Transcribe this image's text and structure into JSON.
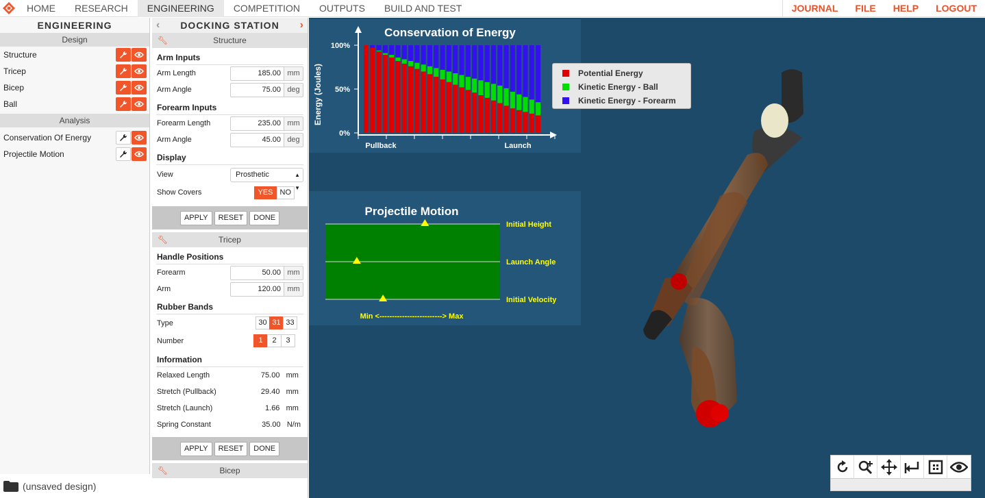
{
  "nav": {
    "items": [
      "HOME",
      "RESEARCH",
      "ENGINEERING",
      "COMPETITION",
      "OUTPUTS",
      "BUILD AND TEST"
    ],
    "active": "ENGINEERING",
    "right_items": [
      "JOURNAL",
      "FILE",
      "HELP",
      "LOGOUT"
    ],
    "accent_color": "#e8532a"
  },
  "left": {
    "title": "ENGINEERING",
    "design_label": "Design",
    "design_items": [
      "Structure",
      "Tricep",
      "Bicep",
      "Ball"
    ],
    "analysis_label": "Analysis",
    "analysis_items": [
      "Conservation Of Energy",
      "Projectile Motion"
    ],
    "footer": "(unsaved design)"
  },
  "mid": {
    "title": "DOCKING STATION",
    "structure": {
      "header": "Structure",
      "arm_inputs": "Arm Inputs",
      "arm_length_label": "Arm Length",
      "arm_length": "185.00",
      "arm_length_unit": "mm",
      "arm_angle_label": "Arm Angle",
      "arm_angle": "75.00",
      "arm_angle_unit": "deg",
      "forearm_inputs": "Forearm Inputs",
      "forearm_length_label": "Forearm Length",
      "forearm_length": "235.00",
      "forearm_length_unit": "mm",
      "forearm_angle_label": "Arm Angle",
      "forearm_angle": "45.00",
      "forearm_angle_unit": "deg",
      "display": "Display",
      "view_label": "View",
      "view_value": "Prosthetic",
      "covers_label": "Show Covers",
      "yes": "YES",
      "no": "NO"
    },
    "tricep": {
      "header": "Tricep",
      "handle_positions": "Handle Positions",
      "forearm_label": "Forearm",
      "forearm": "50.00",
      "forearm_unit": "mm",
      "arm_label": "Arm",
      "arm": "120.00",
      "arm_unit": "mm",
      "rubber_bands": "Rubber Bands",
      "type_label": "Type",
      "types": [
        "30",
        "31",
        "33"
      ],
      "type_selected": "31",
      "number_label": "Number",
      "numbers": [
        "1",
        "2",
        "3"
      ],
      "number_selected": "1",
      "information": "Information",
      "relaxed_label": "Relaxed Length",
      "relaxed": "75.00",
      "relaxed_unit": "mm",
      "pullback_label": "Stretch (Pullback)",
      "pullback": "29.40",
      "pullback_unit": "mm",
      "launch_label": "Stretch (Launch)",
      "launch": "1.66",
      "launch_unit": "mm",
      "spring_label": "Spring Constant",
      "spring": "35.00",
      "spring_unit": "N/m"
    },
    "apply": "APPLY",
    "reset": "RESET",
    "done": "DONE",
    "bicep_header": "Bicep"
  },
  "chart_data": [
    {
      "type": "bar",
      "title": "Conservation of Energy",
      "ylabel": "Energy (Joules)",
      "xtick_labels": [
        "Pullback",
        "Launch"
      ],
      "ytick_labels": [
        "0%",
        "50%",
        "100%"
      ],
      "ylim": [
        0,
        100
      ],
      "stacked": true,
      "series": [
        {
          "name": "Potential Energy",
          "color": "#e00000",
          "values": [
            100,
            97,
            93,
            89,
            86,
            82,
            79,
            76,
            73,
            70,
            67,
            64,
            61,
            58,
            55,
            52,
            49,
            46,
            43,
            40,
            37,
            34,
            31,
            28,
            26,
            24,
            22,
            20,
            18,
            16,
            14,
            12,
            10,
            8,
            6,
            4,
            2,
            1
          ]
        },
        {
          "name": "Kinetic Energy - Ball",
          "color": "#00dd00",
          "values": [
            0,
            0,
            1,
            2,
            3,
            4,
            5,
            6,
            7,
            8,
            9,
            10,
            11,
            12,
            13,
            14,
            15,
            16,
            17,
            18,
            19,
            20,
            20,
            19,
            18,
            17,
            16,
            15
          ]
        },
        {
          "name": "Kinetic Energy - Forearm",
          "color": "#3311ee",
          "values": [
            0,
            3,
            6,
            9,
            11,
            14,
            16,
            18,
            20,
            22,
            24,
            26,
            28,
            30,
            32,
            34,
            36,
            38,
            40,
            42,
            44,
            46,
            49,
            53,
            56,
            59,
            62,
            65
          ]
        }
      ],
      "legend": "right"
    },
    {
      "type": "scatter",
      "title": "Projectile Motion",
      "series": [
        {
          "name": "Initial Height",
          "value": 0.57
        },
        {
          "name": "Launch Angle",
          "value": 0.18
        },
        {
          "name": "Initial Velocity",
          "value": 0.33
        }
      ],
      "xlabel": "Min <-------------------------> Max",
      "color": "#008000"
    }
  ],
  "toolbar": {
    "icons": [
      "rotate-icon",
      "zoom-icon",
      "pan-icon",
      "reset-view-icon",
      "fit-icon",
      "visibility-icon"
    ]
  }
}
